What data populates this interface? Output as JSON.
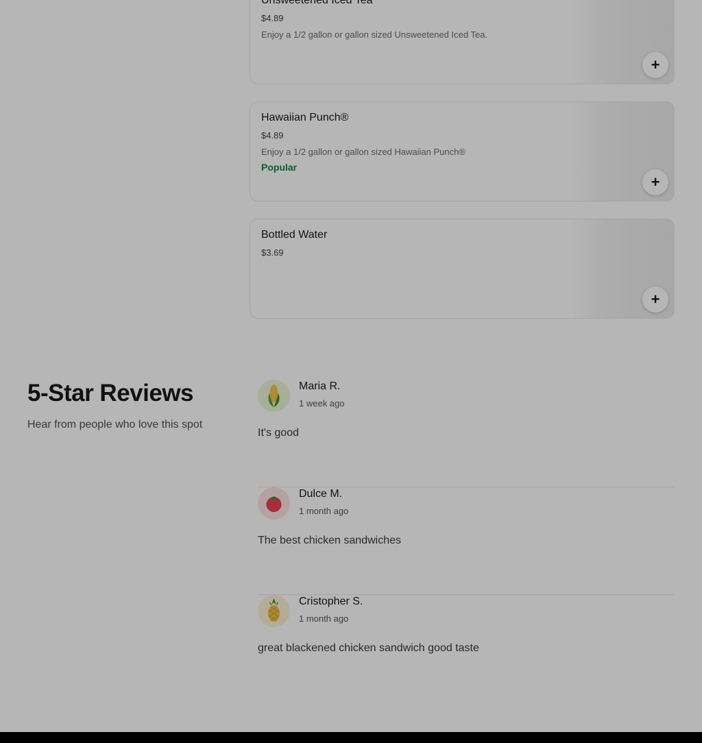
{
  "menu_items": [
    {
      "name": "Unsweetened Iced Tea",
      "price": "$4.89",
      "description": "Enjoy a 1/2 gallon or gallon sized Unsweetened Iced Tea.",
      "tag": ""
    },
    {
      "name": "Hawaiian Punch®",
      "price": "$4.89",
      "description": "Enjoy a 1/2 gallon or gallon sized Hawaiian Punch®",
      "tag": "Popular"
    },
    {
      "name": "Bottled Water",
      "price": "$3.69",
      "description": "",
      "tag": ""
    }
  ],
  "add_button_icon": "plus-icon",
  "add_button_glyph": "+",
  "reviews_section": {
    "title": "5-Star Reviews",
    "subtitle": "Hear from people who love this spot",
    "reviews": [
      {
        "name": "Maria R.",
        "time": "1 week ago",
        "text": "It's good",
        "avatar_icon": "corn-icon",
        "avatar_bg": "#e9f6d6"
      },
      {
        "name": "Dulce M.",
        "time": "1 month ago",
        "text": "The best chicken sandwiches",
        "avatar_icon": "tomato-icon",
        "avatar_bg": "#fde3e3"
      },
      {
        "name": "Cristopher S.",
        "time": "1 month ago",
        "text": "great blackened chicken sandwich good taste",
        "avatar_icon": "pineapple-icon",
        "avatar_bg": "#fdf2d4"
      }
    ]
  },
  "colors": {
    "popular_tag": "#0e8345",
    "overlay": "rgba(0,0,0,0.285)"
  }
}
